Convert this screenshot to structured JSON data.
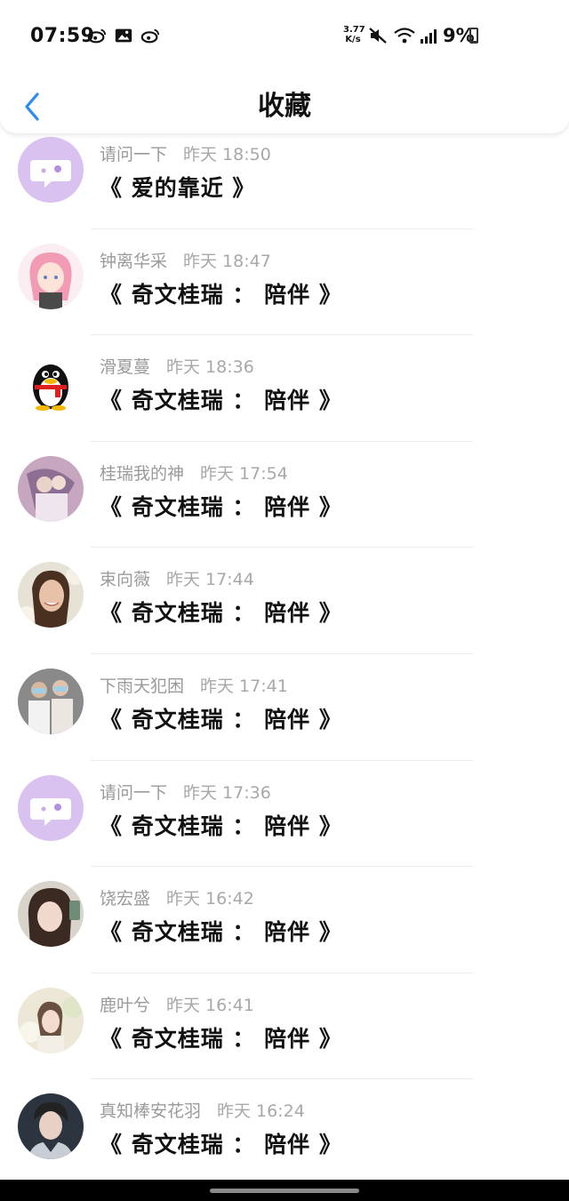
{
  "status_bar": {
    "time": "07:59",
    "net_speed_top": "3.77",
    "net_speed_bottom": "K/s",
    "battery_percent": "9%",
    "battery_level": 0.09,
    "icons_left": [
      "weibo-icon",
      "image-icon",
      "weibo-icon"
    ],
    "icons_right": [
      "mute-icon",
      "wifi-icon",
      "signal-icon"
    ]
  },
  "header": {
    "title": "收藏",
    "back_icon": "chevron-left-icon",
    "accent_color": "#2a8cf0"
  },
  "items": [
    {
      "user": "请问一下",
      "time": "昨天 18:50",
      "title": "《 爱的靠近 》",
      "avatar": "chat-bubble-avatar"
    },
    {
      "user": "钟离华采",
      "time": "昨天 18:47",
      "title": "《 奇文桂瑞 ： 陪伴 》",
      "avatar": "anime-girl-avatar"
    },
    {
      "user": "滑夏蔓",
      "time": "昨天 18:36",
      "title": "《 奇文桂瑞 ： 陪伴 》",
      "avatar": "qq-penguin-avatar"
    },
    {
      "user": "桂瑞我的神",
      "time": "昨天 17:54",
      "title": "《 奇文桂瑞 ： 陪伴 》",
      "avatar": "couple-photo-avatar"
    },
    {
      "user": "束向薇",
      "time": "昨天 17:44",
      "title": "《 奇文桂瑞 ： 陪伴 》",
      "avatar": "woman-photo-avatar"
    },
    {
      "user": "下雨天犯困",
      "time": "昨天 17:41",
      "title": "《 奇文桂瑞 ： 陪伴 》",
      "avatar": "two-people-avatar"
    },
    {
      "user": "请问一下",
      "time": "昨天 17:36",
      "title": "《 奇文桂瑞 ： 陪伴 》",
      "avatar": "chat-bubble-avatar"
    },
    {
      "user": "饶宏盛",
      "time": "昨天 16:42",
      "title": "《 奇文桂瑞 ： 陪伴 》",
      "avatar": "girl-photo-avatar"
    },
    {
      "user": "鹿叶兮",
      "time": "昨天 16:41",
      "title": "《 奇文桂瑞 ： 陪伴 》",
      "avatar": "flower-girl-avatar"
    },
    {
      "user": "真知棒安花羽",
      "time": "昨天 16:24",
      "title": "《 奇文桂瑞 ： 陪伴 》",
      "avatar": "man-photo-avatar"
    }
  ]
}
